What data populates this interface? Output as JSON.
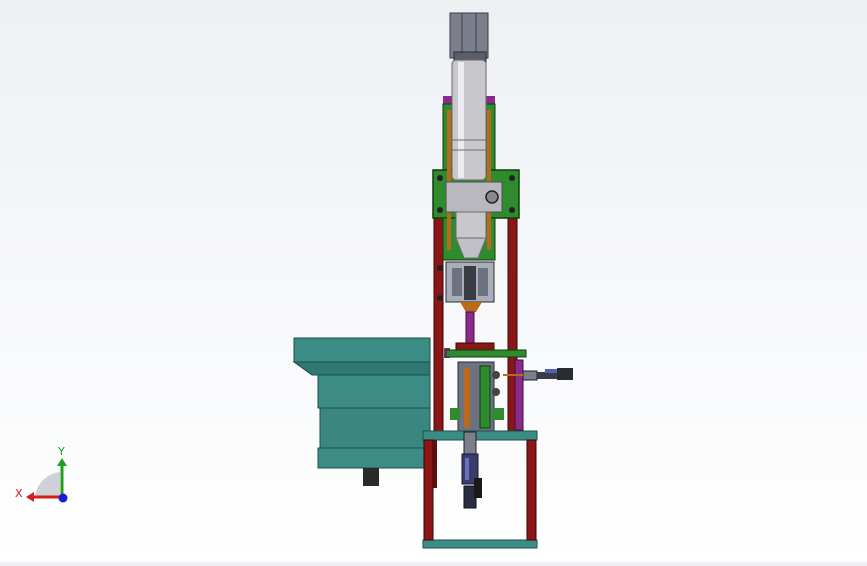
{
  "viewport": {
    "background_top": "#eef0f4",
    "background_bottom": "#ffffff"
  },
  "triad": {
    "x_label": "X",
    "y_label": "Y",
    "x_color": "#d41c1c",
    "y_color": "#1ca01c",
    "z_color": "#1c1cd4"
  },
  "colors": {
    "frame_red": "#8a1616",
    "frame_green": "#2e8b2e",
    "teal": "#3c8c86",
    "teal_dark": "#2d6e69",
    "purple": "#8a2a8a",
    "silver": "#c8c8cc",
    "orange": "#b86a1a",
    "gray": "#7b7f8c",
    "dark": "#222222"
  }
}
